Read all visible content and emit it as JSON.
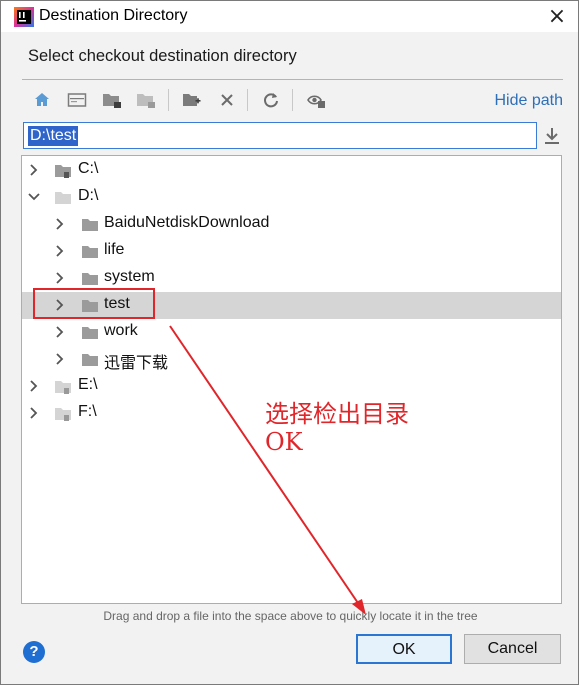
{
  "window": {
    "title": "Destination Directory",
    "close_glyph": "×"
  },
  "prompt": "Select checkout destination directory",
  "toolbar": {
    "buttons": [
      "home-icon",
      "desktop-icon",
      "project-folder-icon",
      "module-folder-icon",
      "new-folder-icon",
      "delete-icon",
      "refresh-icon",
      "show-hidden-icon"
    ],
    "hide_path_label": "Hide path"
  },
  "path_input": {
    "value": "D:\\test"
  },
  "tree": {
    "rows": [
      {
        "label": "C:\\",
        "kind": "drive",
        "expanded": false,
        "depth": 0
      },
      {
        "label": "D:\\",
        "kind": "drive",
        "expanded": true,
        "depth": 0
      },
      {
        "label": "BaiduNetdiskDownload",
        "kind": "folder",
        "expanded": false,
        "depth": 1
      },
      {
        "label": "life",
        "kind": "folder",
        "expanded": false,
        "depth": 1
      },
      {
        "label": "system",
        "kind": "folder",
        "expanded": false,
        "depth": 1
      },
      {
        "label": "test",
        "kind": "folder",
        "expanded": false,
        "depth": 1,
        "selected": true
      },
      {
        "label": "work",
        "kind": "folder",
        "expanded": false,
        "depth": 1
      },
      {
        "label": "迅雷下载",
        "kind": "folder",
        "expanded": false,
        "depth": 1
      },
      {
        "label": "E:\\",
        "kind": "drive",
        "expanded": false,
        "depth": 0
      },
      {
        "label": "F:\\",
        "kind": "drive",
        "expanded": false,
        "depth": 0
      }
    ]
  },
  "hint": "Drag and drop a file into the space above to quickly locate it in the tree",
  "help_label": "?",
  "buttons": {
    "ok": "OK",
    "cancel": "Cancel"
  },
  "annotation": {
    "line1": "选择检出目录",
    "line2": "OK",
    "color": "#e0262a"
  },
  "colors": {
    "accent": "#2f65ca",
    "link": "#2d6fb8",
    "selected_row": "#d5d5d5"
  }
}
